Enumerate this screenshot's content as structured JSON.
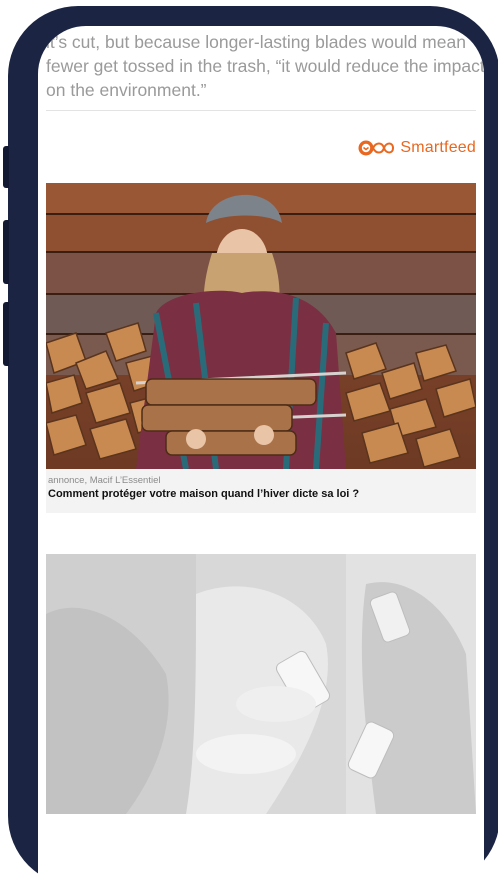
{
  "article": {
    "text": "it’s cut, but because longer-lasting blades would mean fewer get tossed in the trash, “it would reduce the impact on the environment.”"
  },
  "brand": {
    "name": "Smartfeed",
    "color": "#e9671f",
    "icon": "smartfeed-infinity-icon"
  },
  "cards": [
    {
      "sponsor": "annonce, Macif L’Essentiel",
      "headline": "Comment protéger votre maison quand l’hiver dicte sa loi ?",
      "image": "woman-carrying-firewood-photo"
    },
    {
      "image": "people-using-smartphones-photo"
    }
  ],
  "colors": {
    "phone_frame": "#1b2543",
    "text_muted": "#9a9a9a"
  }
}
